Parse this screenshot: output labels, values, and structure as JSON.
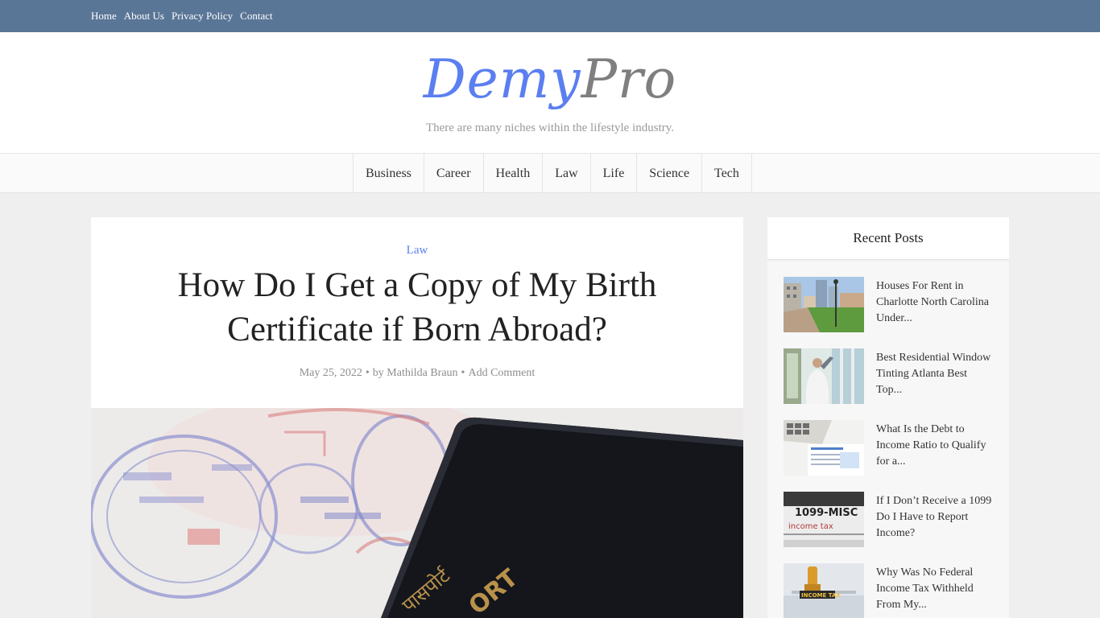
{
  "topnav": {
    "links": [
      "Home",
      "About Us",
      "Privacy Policy",
      "Contact"
    ]
  },
  "site": {
    "logo_part1": "Demy",
    "logo_part2": "Pro",
    "tagline": "There are many niches within the lifestyle industry."
  },
  "categories": [
    "Business",
    "Career",
    "Health",
    "Law",
    "Life",
    "Science",
    "Tech"
  ],
  "article": {
    "category": "Law",
    "title": "How Do I Get a Copy of My Birth Certificate if Born Abroad?",
    "date": "May 25, 2022",
    "author": "by Mathilda Braun",
    "comment_link": "Add Comment",
    "image_text": {
      "cover": "ORT",
      "hindi": "पासपोर्ट"
    }
  },
  "sidebar": {
    "title": "Recent Posts",
    "posts": [
      {
        "title": "Houses For Rent in Charlotte North Carolina Under..."
      },
      {
        "title": "Best Residential Window Tinting Atlanta Best Top..."
      },
      {
        "title": "What Is the Debt to Income Ratio to Qualify for a..."
      },
      {
        "title": "If I Don’t Receive a 1099 Do I Have to Report Income?"
      },
      {
        "title": "Why Was No Federal Income Tax Withheld From My..."
      }
    ],
    "thumb_text": {
      "form_label": "1099-MISC",
      "form_sub": "income tax",
      "stamp_label": "INCOME TAX"
    }
  },
  "colors": {
    "topbar": "#5a7697",
    "accent": "#5b7ff0",
    "logo_grey": "#7f7f7f"
  }
}
